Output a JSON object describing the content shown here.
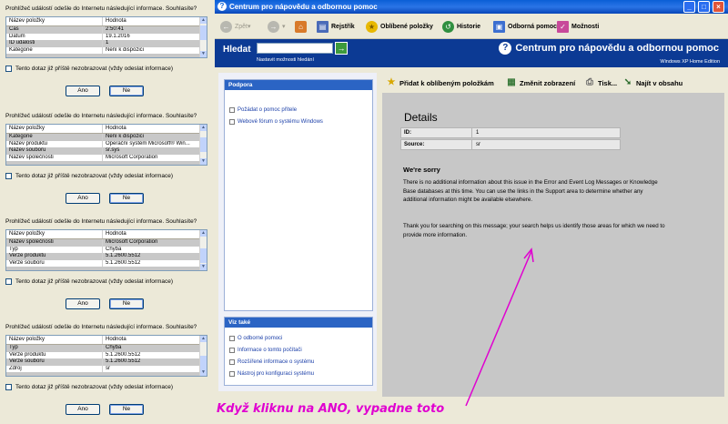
{
  "dialogs": [
    {
      "question": "Prohlížeč událostí odešle do Internetu následující informace. Souhlasíte?",
      "columns": [
        "Název položky",
        "Hodnota"
      ],
      "rows": [
        [
          "Čas",
          "2:50:41"
        ],
        [
          "Datum",
          "19.1.2016"
        ],
        [
          "ID události",
          "1"
        ],
        [
          "Kategorie",
          "Není k dispozici"
        ]
      ],
      "checkbox": "Tento dotaz již příště nezobrazovat (vždy odeslat informace)",
      "yes": "Ano",
      "no": "Ne"
    },
    {
      "question": "Prohlížeč událostí odešle do Internetu následující informace. Souhlasíte?",
      "columns": [
        "Název položky",
        "Hodnota"
      ],
      "rows": [
        [
          "Kategorie",
          "Není k dispozici"
        ],
        [
          "Název produktu",
          "Operační systém Microsoft® Win..."
        ],
        [
          "Název souboru",
          "sr.sys"
        ],
        [
          "Název společnosti",
          "Microsoft Corporation"
        ]
      ],
      "checkbox": "Tento dotaz již příště nezobrazovat (vždy odeslat informace)",
      "yes": "Ano",
      "no": "Ne"
    },
    {
      "question": "Prohlížeč událostí odešle do Internetu následující informace. Souhlasíte?",
      "columns": [
        "Název položky",
        "Hodnota"
      ],
      "rows": [
        [
          "Název společnosti",
          "Microsoft Corporation"
        ],
        [
          "Typ",
          "Chyba"
        ],
        [
          "Verze produktu",
          "5.1.2600.5512"
        ],
        [
          "Verze souboru",
          "5.1.2600.5512"
        ]
      ],
      "checkbox": "Tento dotaz již příště nezobrazovat (vždy odeslat informace)",
      "yes": "Ano",
      "no": "Ne"
    },
    {
      "question": "Prohlížeč událostí odešle do Internetu následující informace. Souhlasíte?",
      "columns": [
        "Název položky",
        "Hodnota"
      ],
      "rows": [
        [
          "Typ",
          "Chyba"
        ],
        [
          "Verze produktu",
          "5.1.2600.5512"
        ],
        [
          "Verze souboru",
          "5.1.2600.5512"
        ],
        [
          "Zdroj",
          "sr"
        ]
      ],
      "checkbox": "Tento dotaz již příště nezobrazovat (vždy odeslat informace)",
      "yes": "Ano",
      "no": "Ne"
    }
  ],
  "window": {
    "title": "Centrum pro nápovědu a odbornou pomoc",
    "controls": {
      "minimize": "_",
      "maximize": "□",
      "close": "×"
    }
  },
  "toolbar": {
    "back": "Zpět",
    "forward": "→",
    "home": "⌂",
    "index": "Rejstřík",
    "favorites": "Oblíbené položky",
    "history": "Historie",
    "support": "Odborná pomoc",
    "options": "Možnosti"
  },
  "search": {
    "label": "Hledat",
    "placeholder": "",
    "go": "→",
    "advanced": "Nastavit možnosti hledání"
  },
  "banner": {
    "title": "Centrum pro nápovědu a odbornou pomoc",
    "edition": "Windows XP Home Edition"
  },
  "support_panel": {
    "title": "Podpora",
    "links": [
      "Požádat o pomoc přítele",
      "Webové fórum o systému Windows"
    ]
  },
  "see_also_panel": {
    "title": "Viz také",
    "links": [
      "O odborné pomoci",
      "Informace o tomto počítači",
      "Rozšířené informace o systému",
      "Nástroj pro konfiguraci systému"
    ]
  },
  "content_toolbar": {
    "add_favorites": "Přidat k oblíbeným položkám",
    "change_view": "Změnit zobrazení",
    "print": "Tisk...",
    "find": "Najít v obsahu"
  },
  "details": {
    "heading": "Details",
    "rows": [
      {
        "key": "ID:",
        "value": "1"
      },
      {
        "key": "Source:",
        "value": "sr"
      }
    ],
    "sorry_heading": "We're sorry",
    "paragraph1": "There is no additional information about this issue in the Error and Event Log Messages or Knowledge Base databases at this time. You can use the links in the Support area to determine whether any additional information might be available elsewhere.",
    "paragraph2": "Thank you for searching on this message; your search helps us identify those areas for which we need to provide more information."
  },
  "annotation": {
    "text": "Když kliknu na ANO, vypadne toto",
    "color": "#e000d0"
  },
  "colors": {
    "banner": "#0c3a94",
    "content_bg": "#c7c7c7",
    "panel_header": "#2b64c4"
  }
}
